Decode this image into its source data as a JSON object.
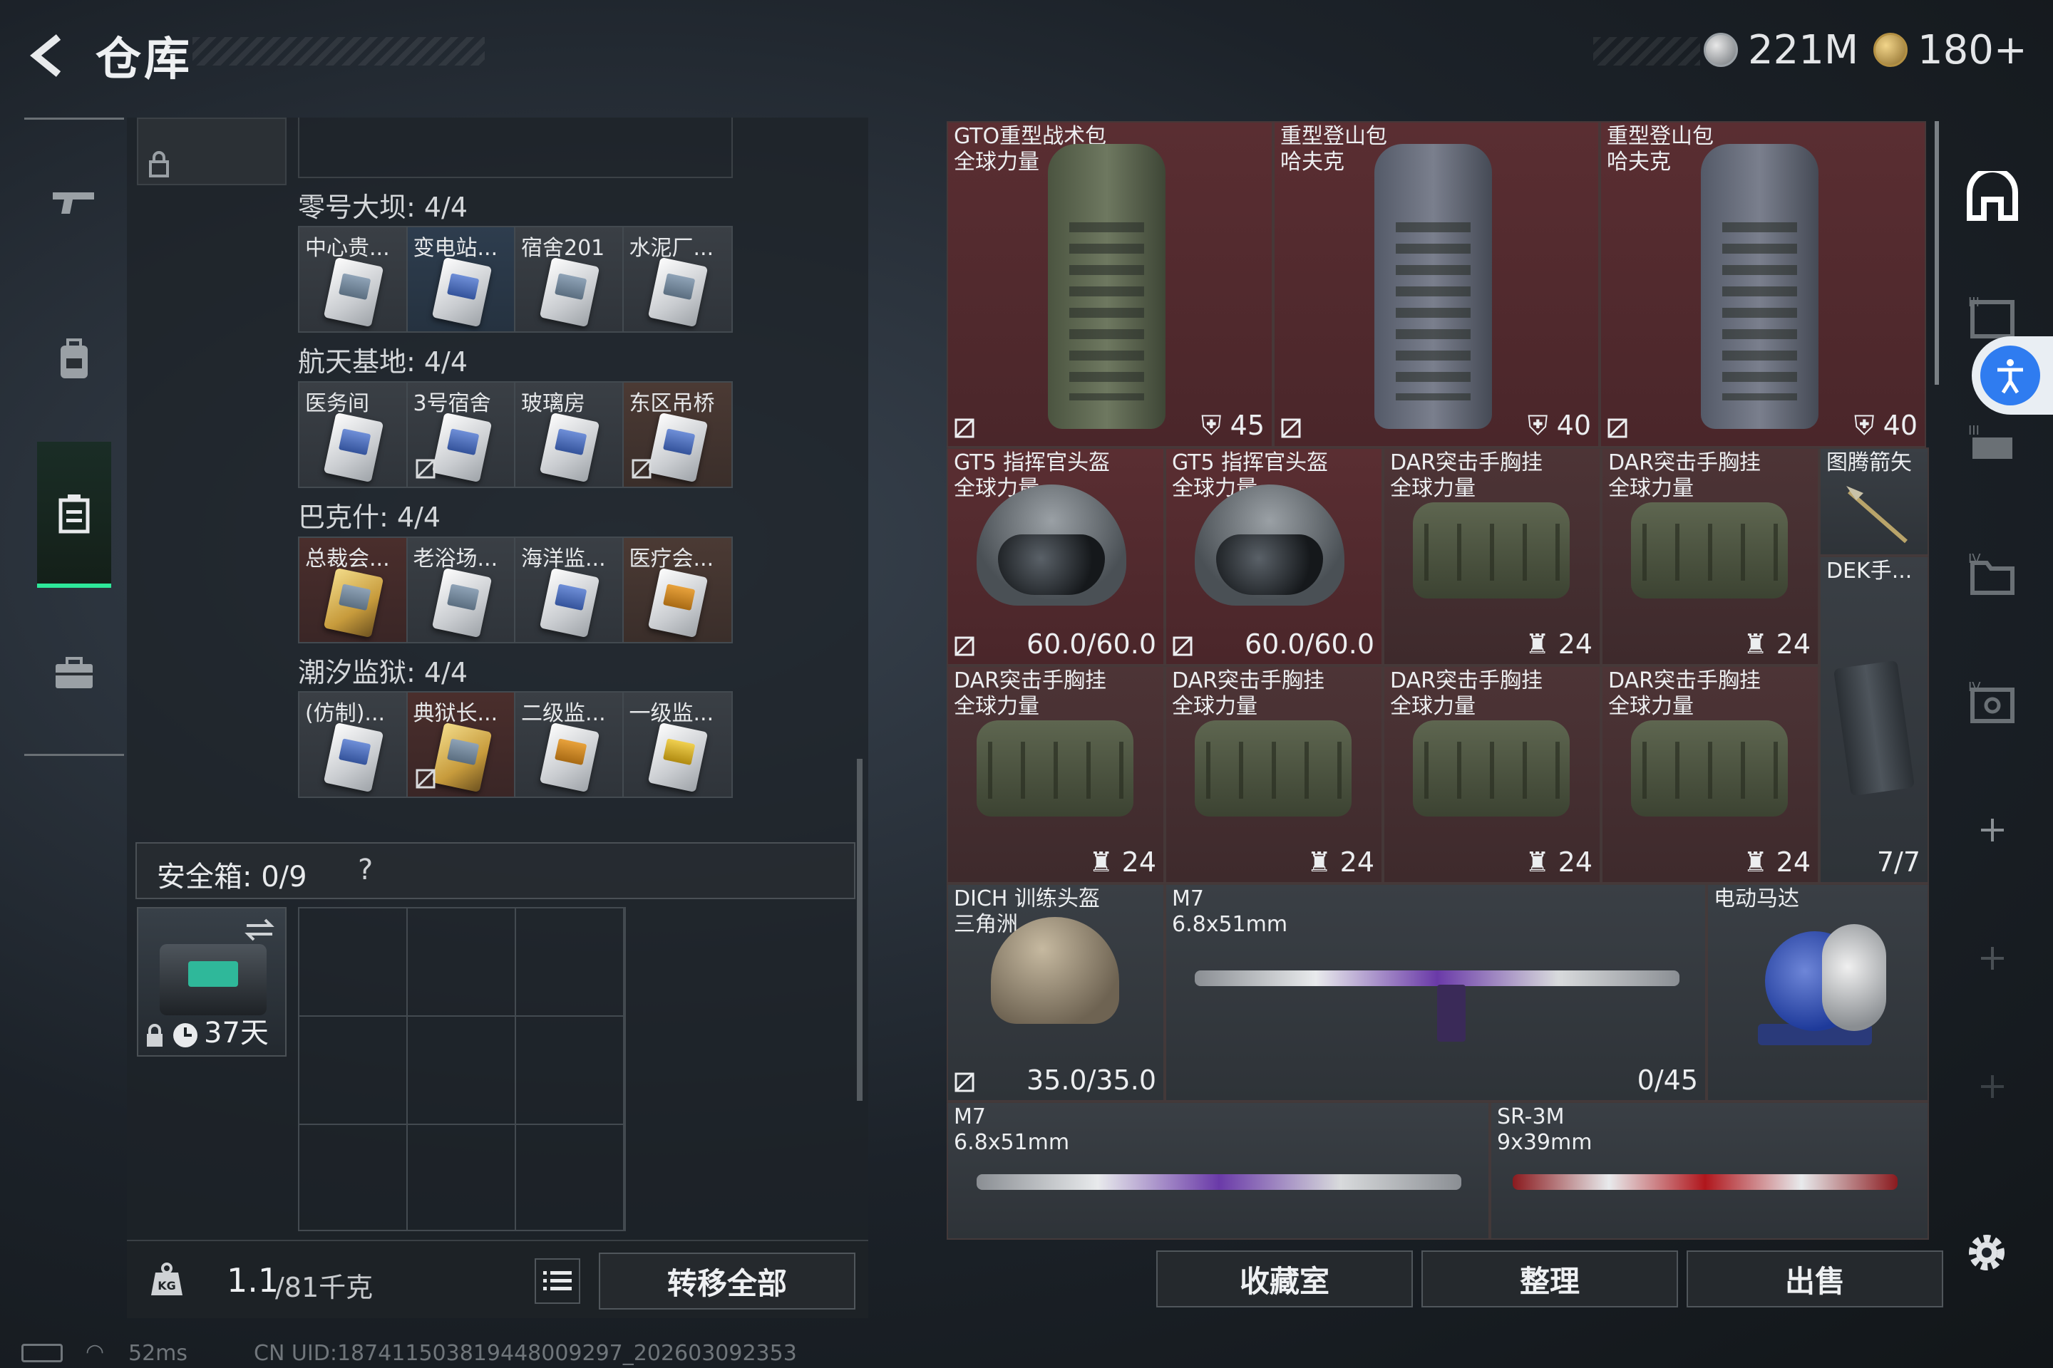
{
  "header": {
    "title": "仓库",
    "currency_silver": "221M",
    "currency_gold": "180+"
  },
  "left_nav": [
    "gun-icon",
    "backpack-icon",
    "container-icon",
    "briefcase-icon"
  ],
  "groups": [
    {
      "title": "零号大坝: 4/4",
      "cards": [
        {
          "label": "中心贵...",
          "bg": "grey",
          "tint": ""
        },
        {
          "label": "变电站...",
          "bg": "blue",
          "tint": "blue"
        },
        {
          "label": "宿舍201",
          "bg": "grey",
          "tint": ""
        },
        {
          "label": "水泥厂...",
          "bg": "grey",
          "tint": ""
        }
      ]
    },
    {
      "title": "航天基地: 4/4",
      "cards": [
        {
          "label": "医务间",
          "bg": "grey",
          "tint": ""
        },
        {
          "label": "3号宿舍",
          "bg": "grey",
          "tint": "",
          "noswap": true
        },
        {
          "label": "玻璃房",
          "bg": "grey",
          "tint": ""
        },
        {
          "label": "东区吊桥",
          "bg": "brown",
          "tint": "",
          "noswap": true
        }
      ]
    },
    {
      "title": "巴克什: 4/4",
      "cards": [
        {
          "label": "总裁会...",
          "bg": "red",
          "tint": "gold"
        },
        {
          "label": "老浴场...",
          "bg": "grey",
          "tint": ""
        },
        {
          "label": "海洋监...",
          "bg": "grey",
          "tint": ""
        },
        {
          "label": "医疗会...",
          "bg": "brown",
          "tint": "orange"
        }
      ]
    },
    {
      "title": "潮汐监狱: 4/4",
      "cards": [
        {
          "label": "(仿制)...",
          "bg": "grey",
          "tint": ""
        },
        {
          "label": "典狱长...",
          "bg": "red",
          "tint": "gold",
          "noswap": true
        },
        {
          "label": "二级监...",
          "bg": "grey",
          "tint": "orange"
        },
        {
          "label": "一级监...",
          "bg": "grey",
          "tint": "yellow"
        }
      ]
    }
  ],
  "safebox": {
    "title": "安全箱: 0/9",
    "help": "?",
    "item_timer": "37天"
  },
  "weight": {
    "current": "1.1",
    "max": "/81千克",
    "transfer_all": "转移全部"
  },
  "items": {
    "pack1": {
      "name1": "GTO重型战术包",
      "name2": "全球力量",
      "stat": "45"
    },
    "pack2": {
      "name1": "重型登山包",
      "name2": "哈夫克",
      "stat": "40"
    },
    "pack3": {
      "name1": "重型登山包",
      "name2": "哈夫克",
      "stat": "40"
    },
    "helm1": {
      "name1": "GT5 指挥官头盔",
      "name2": "全球力量",
      "stat": "60.0/60.0"
    },
    "helm2": {
      "name1": "GT5 指挥官头盔",
      "name2": "全球力量",
      "stat": "60.0/60.0"
    },
    "vest1": {
      "name1": "DAR突击手胸挂",
      "name2": "全球力量",
      "stat": "24"
    },
    "vest2": {
      "name1": "DAR突击手胸挂",
      "name2": "全球力量",
      "stat": "24"
    },
    "vest3": {
      "name1": "DAR突击手胸挂",
      "name2": "全球力量",
      "stat": "24"
    },
    "vest4": {
      "name1": "DAR突击手胸挂",
      "name2": "全球力量",
      "stat": "24"
    },
    "vest5": {
      "name1": "DAR突击手胸挂",
      "name2": "全球力量",
      "stat": "24"
    },
    "vest6": {
      "name1": "DAR突击手胸挂",
      "name2": "全球力量",
      "stat": "24"
    },
    "arrow": {
      "name1": "图腾箭矢"
    },
    "dek": {
      "name1": "DEK手...",
      "stat": "7/7"
    },
    "dich": {
      "name1": "DICH 训练头盔",
      "name2": "三角洲",
      "stat": "35.0/35.0"
    },
    "m7a": {
      "name1": "M7",
      "name2": "6.8x51mm",
      "stat": "0/45"
    },
    "motor": {
      "name1": "电动马达"
    },
    "m7b": {
      "name1": "M7",
      "name2": "6.8x51mm"
    },
    "sr3m": {
      "name1": "SR-3M",
      "name2": "9x39mm"
    }
  },
  "buttons": {
    "collection": "收藏室",
    "organize": "整理",
    "sell": "出售"
  },
  "status": {
    "ping": "52ms",
    "uid": "CN UID:187411503819448009297_202603092353"
  },
  "colors": {
    "accent": "#2ee89a",
    "item_red": "#5a2e32",
    "access_blue": "#2f7cf0"
  }
}
